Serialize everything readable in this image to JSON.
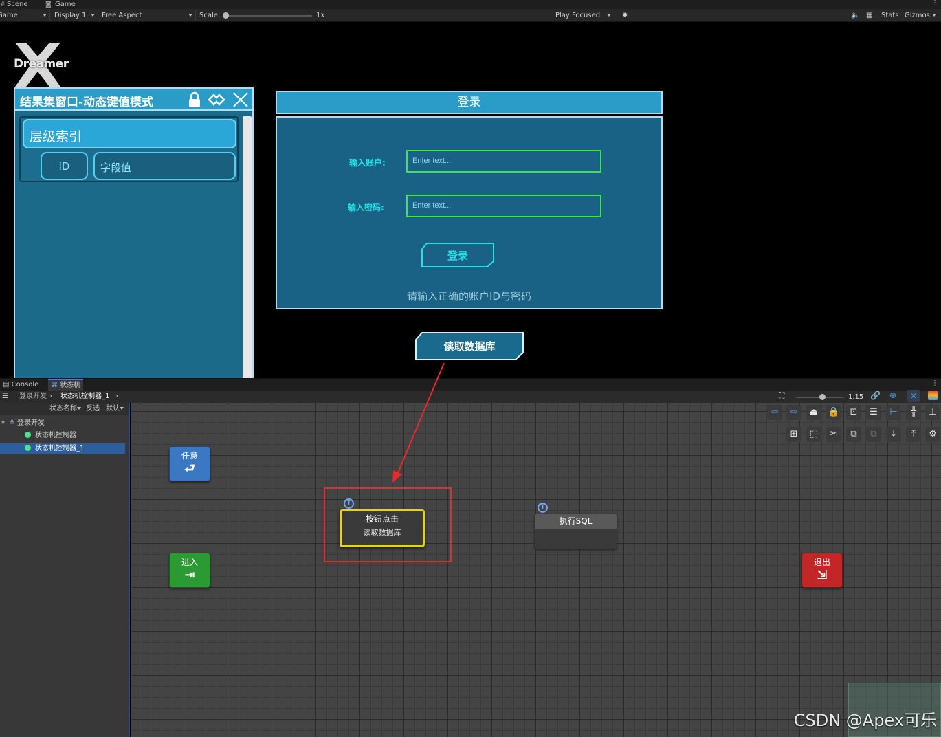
{
  "tabs": {
    "scene": "Scene",
    "game": "Game"
  },
  "game_toolbar": {
    "mode": "Game",
    "display": "Display 1",
    "aspect": "Free Aspect",
    "scale_label": "Scale",
    "scale_value": "1x",
    "play_focused": "Play Focused",
    "stats": "Stats",
    "gizmos": "Gizmos"
  },
  "logo": {
    "word": "Dreamer"
  },
  "result_window": {
    "title": "结果集窗口-动态键值模式",
    "header": "层级索引",
    "chip_id": "ID",
    "chip_field": "字段值"
  },
  "login": {
    "title": "登录",
    "account_label": "输入账户:",
    "account_placeholder": "Enter text...",
    "password_label": "输入密码:",
    "password_placeholder": "Enter text...",
    "button": "登录",
    "hint": "请输入正确的账户ID与密码"
  },
  "read_db_button": "读取数据库",
  "lower_tabs": {
    "console": "Console",
    "fsm": "状态机"
  },
  "breadcrumb": {
    "root": "登录开发",
    "current": "状态机控制器_1"
  },
  "sidebar": {
    "tools": {
      "state_name": "状态名称",
      "invert": "反选",
      "default": "默认"
    },
    "tree": {
      "root": "登录开发",
      "items": [
        "状态机控制器",
        "状态机控制器_1"
      ],
      "selected": "状态机控制器_1"
    }
  },
  "graph": {
    "zoom": "1.15",
    "nodes": {
      "any": "任意",
      "entry": "进入",
      "exit": "退出"
    },
    "states": {
      "button_click": {
        "title": "按钮点击",
        "sub": "读取数据库"
      },
      "exec_sql": {
        "title": "执行SQL"
      }
    },
    "badge": "T"
  },
  "watermark": "CSDN @Apex可乐",
  "colors": {
    "accent_blue": "#2a9cc7",
    "panel_teal": "#1a6285",
    "input_green": "#3ee646",
    "label_cyan": "#21e0e6",
    "highlight_red": "#e52b2b",
    "selected_yellow": "#e8d21d",
    "entry_green": "#2b9a33",
    "exit_red": "#c22626",
    "any_blue": "#3b78c4"
  }
}
